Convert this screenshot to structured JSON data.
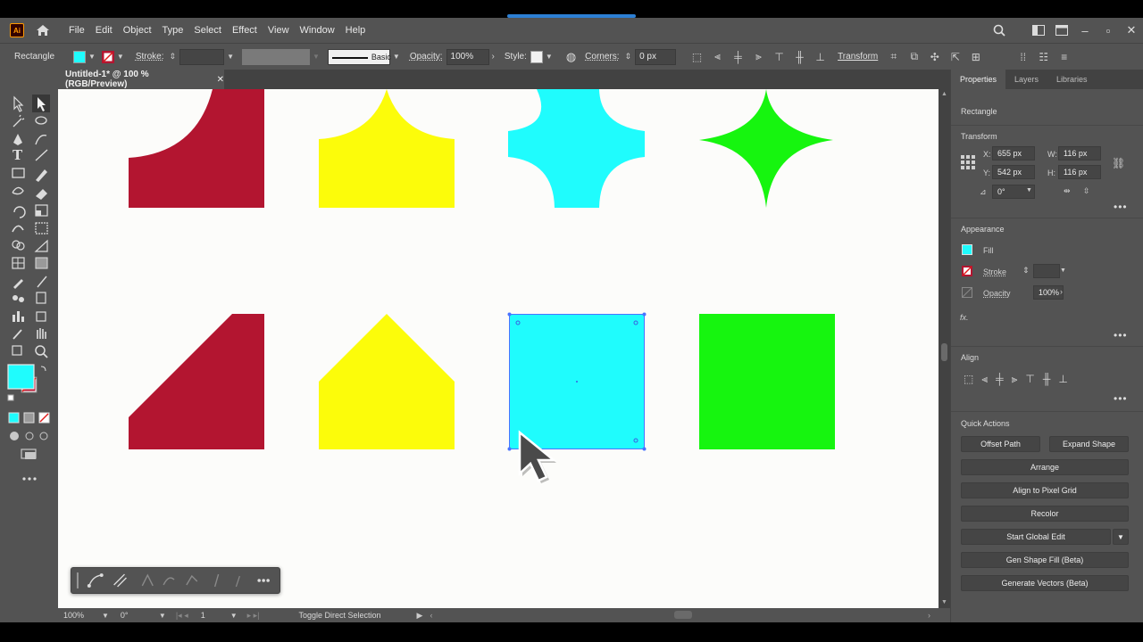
{
  "app": {
    "logo": "Ai"
  },
  "menu": [
    "File",
    "Edit",
    "Object",
    "Type",
    "Select",
    "Effect",
    "View",
    "Window",
    "Help"
  ],
  "control": {
    "object_type": "Rectangle",
    "stroke_label": "Stroke:",
    "brush_label": "Basic",
    "opacity_label": "Opacity:",
    "opacity_value": "100%",
    "style_label": "Style:",
    "corners_label": "Corners:",
    "corners_value": "0 px",
    "transform_label": "Transform"
  },
  "document": {
    "tab_title": "Untitled-1* @ 100 % (RGB/Preview)",
    "close": "✕"
  },
  "colors": {
    "cyan": "#1ffcfd",
    "yellow": "#fcfc0a",
    "green": "#16f50f",
    "crimson": "#b31530",
    "selection": "#4a73ff"
  },
  "properties": {
    "tabs": [
      "Properties",
      "Layers",
      "Libraries"
    ],
    "object_type": "Rectangle",
    "transform": {
      "title": "Transform",
      "x_label": "X:",
      "x": "655 px",
      "y_label": "Y:",
      "y": "542 px",
      "w_label": "W:",
      "w": "116 px",
      "h_label": "H:",
      "h": "116 px",
      "rotate": "0°"
    },
    "appearance": {
      "title": "Appearance",
      "fill_label": "Fill",
      "stroke_label": "Stroke",
      "opacity_label": "Opacity",
      "opacity_value": "100%",
      "fx": "fx."
    },
    "align_title": "Align",
    "quick_actions": {
      "title": "Quick Actions",
      "offset_path": "Offset Path",
      "expand_shape": "Expand Shape",
      "arrange": "Arrange",
      "align_pixel_grid": "Align to Pixel Grid",
      "recolor": "Recolor",
      "start_global_edit": "Start Global Edit",
      "gen_shape_fill": "Gen Shape Fill (Beta)",
      "generate_vectors": "Generate Vectors (Beta)"
    }
  },
  "status": {
    "zoom": "100%",
    "rotation": "0°",
    "artboard": "1",
    "tool_hint": "Toggle Direct Selection"
  }
}
